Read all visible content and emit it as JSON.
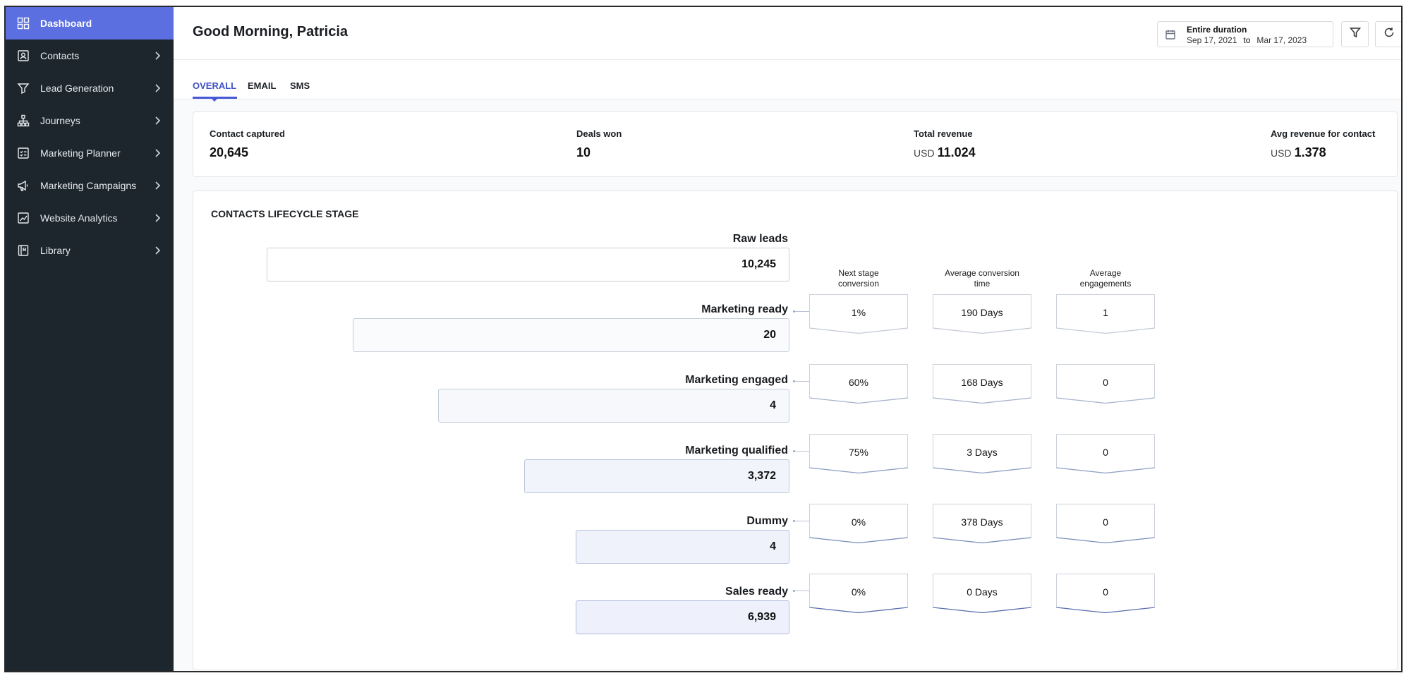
{
  "sidebar": {
    "items": [
      {
        "label": "Dashboard",
        "icon": "dashboard-icon",
        "active": true
      },
      {
        "label": "Contacts",
        "icon": "contacts-icon"
      },
      {
        "label": "Lead Generation",
        "icon": "funnel-icon"
      },
      {
        "label": "Journeys",
        "icon": "journey-icon"
      },
      {
        "label": "Marketing Planner",
        "icon": "planner-icon"
      },
      {
        "label": "Marketing Campaigns",
        "icon": "megaphone-icon"
      },
      {
        "label": "Website Analytics",
        "icon": "analytics-icon"
      },
      {
        "label": "Library",
        "icon": "library-icon"
      }
    ]
  },
  "header": {
    "greeting": "Good Morning, Patricia",
    "date_range": {
      "title": "Entire duration",
      "from": "Sep 17, 2021",
      "to_label": "to",
      "to": "Mar 17, 2023"
    }
  },
  "tabs": [
    {
      "label": "OVERALL",
      "active": true
    },
    {
      "label": "EMAIL"
    },
    {
      "label": "SMS"
    }
  ],
  "stats": [
    {
      "label": "Contact captured",
      "currency": "",
      "value": "20,645"
    },
    {
      "label": "Deals won",
      "currency": "",
      "value": "10"
    },
    {
      "label": "Total revenue",
      "currency": "USD",
      "value": "11.024"
    },
    {
      "label": "Avg revenue for contact",
      "currency": "USD",
      "value": "1.378"
    }
  ],
  "lifecycle": {
    "title": "CONTACTS LIFECYCLE STAGE",
    "columns": [
      "Next stage\nconversion",
      "Average conversion\ntime",
      "Average\nengagements"
    ],
    "stages": [
      {
        "label": "Raw leads",
        "value": "10,245"
      },
      {
        "label": "Marketing ready",
        "value": "20"
      },
      {
        "label": "Marketing engaged",
        "value": "4"
      },
      {
        "label": "Marketing qualified",
        "value": "3,372"
      },
      {
        "label": "Dummy",
        "value": "4"
      },
      {
        "label": "Sales ready",
        "value": "6,939"
      }
    ],
    "metrics": [
      {
        "conversion": "1%",
        "time": "190 Days",
        "engagements": "1"
      },
      {
        "conversion": "60%",
        "time": "168 Days",
        "engagements": "0"
      },
      {
        "conversion": "75%",
        "time": "3 Days",
        "engagements": "0"
      },
      {
        "conversion": "0%",
        "time": "378 Days",
        "engagements": "0"
      },
      {
        "conversion": "0%",
        "time": "0 Days",
        "engagements": "0"
      }
    ]
  },
  "colors": {
    "sidebar_bg": "#1d262d",
    "accent": "#5b6fe0",
    "tab_active": "#3f51c4"
  }
}
